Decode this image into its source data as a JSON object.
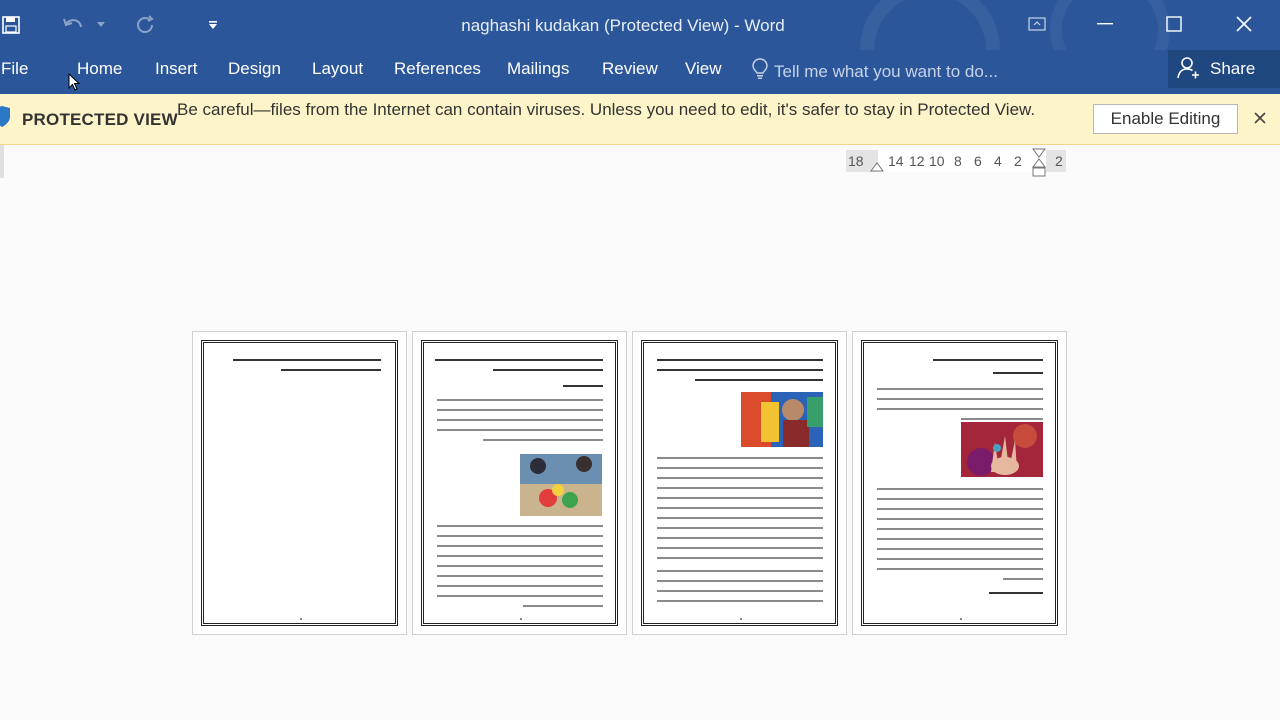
{
  "window": {
    "title": "naghashi kudakan (Protected View) - Word",
    "accent_color": "#2b579a"
  },
  "quick_access": {
    "save_icon": "save-icon",
    "undo_icon": "undo-icon",
    "redo_icon": "repeat-icon",
    "customize_icon": "customize-qat-icon"
  },
  "ribbon": {
    "tabs": [
      "File",
      "Home",
      "Insert",
      "Design",
      "Layout",
      "References",
      "Mailings",
      "Review",
      "View"
    ],
    "tell_me_placeholder": "Tell me what you want to do...",
    "share_label": "Share"
  },
  "protected_view": {
    "label": "PROTECTED VIEW",
    "message": "Be careful—files from the Internet can contain viruses. Unless you need to edit, it's safer to stay in Protected View.",
    "enable_button": "Enable Editing",
    "bar_color": "#fdf5c9"
  },
  "ruler": {
    "numbers": [
      "18",
      "14",
      "12",
      "10",
      "8",
      "6",
      "4",
      "2",
      "2"
    ]
  },
  "document": {
    "page_count": 4
  }
}
